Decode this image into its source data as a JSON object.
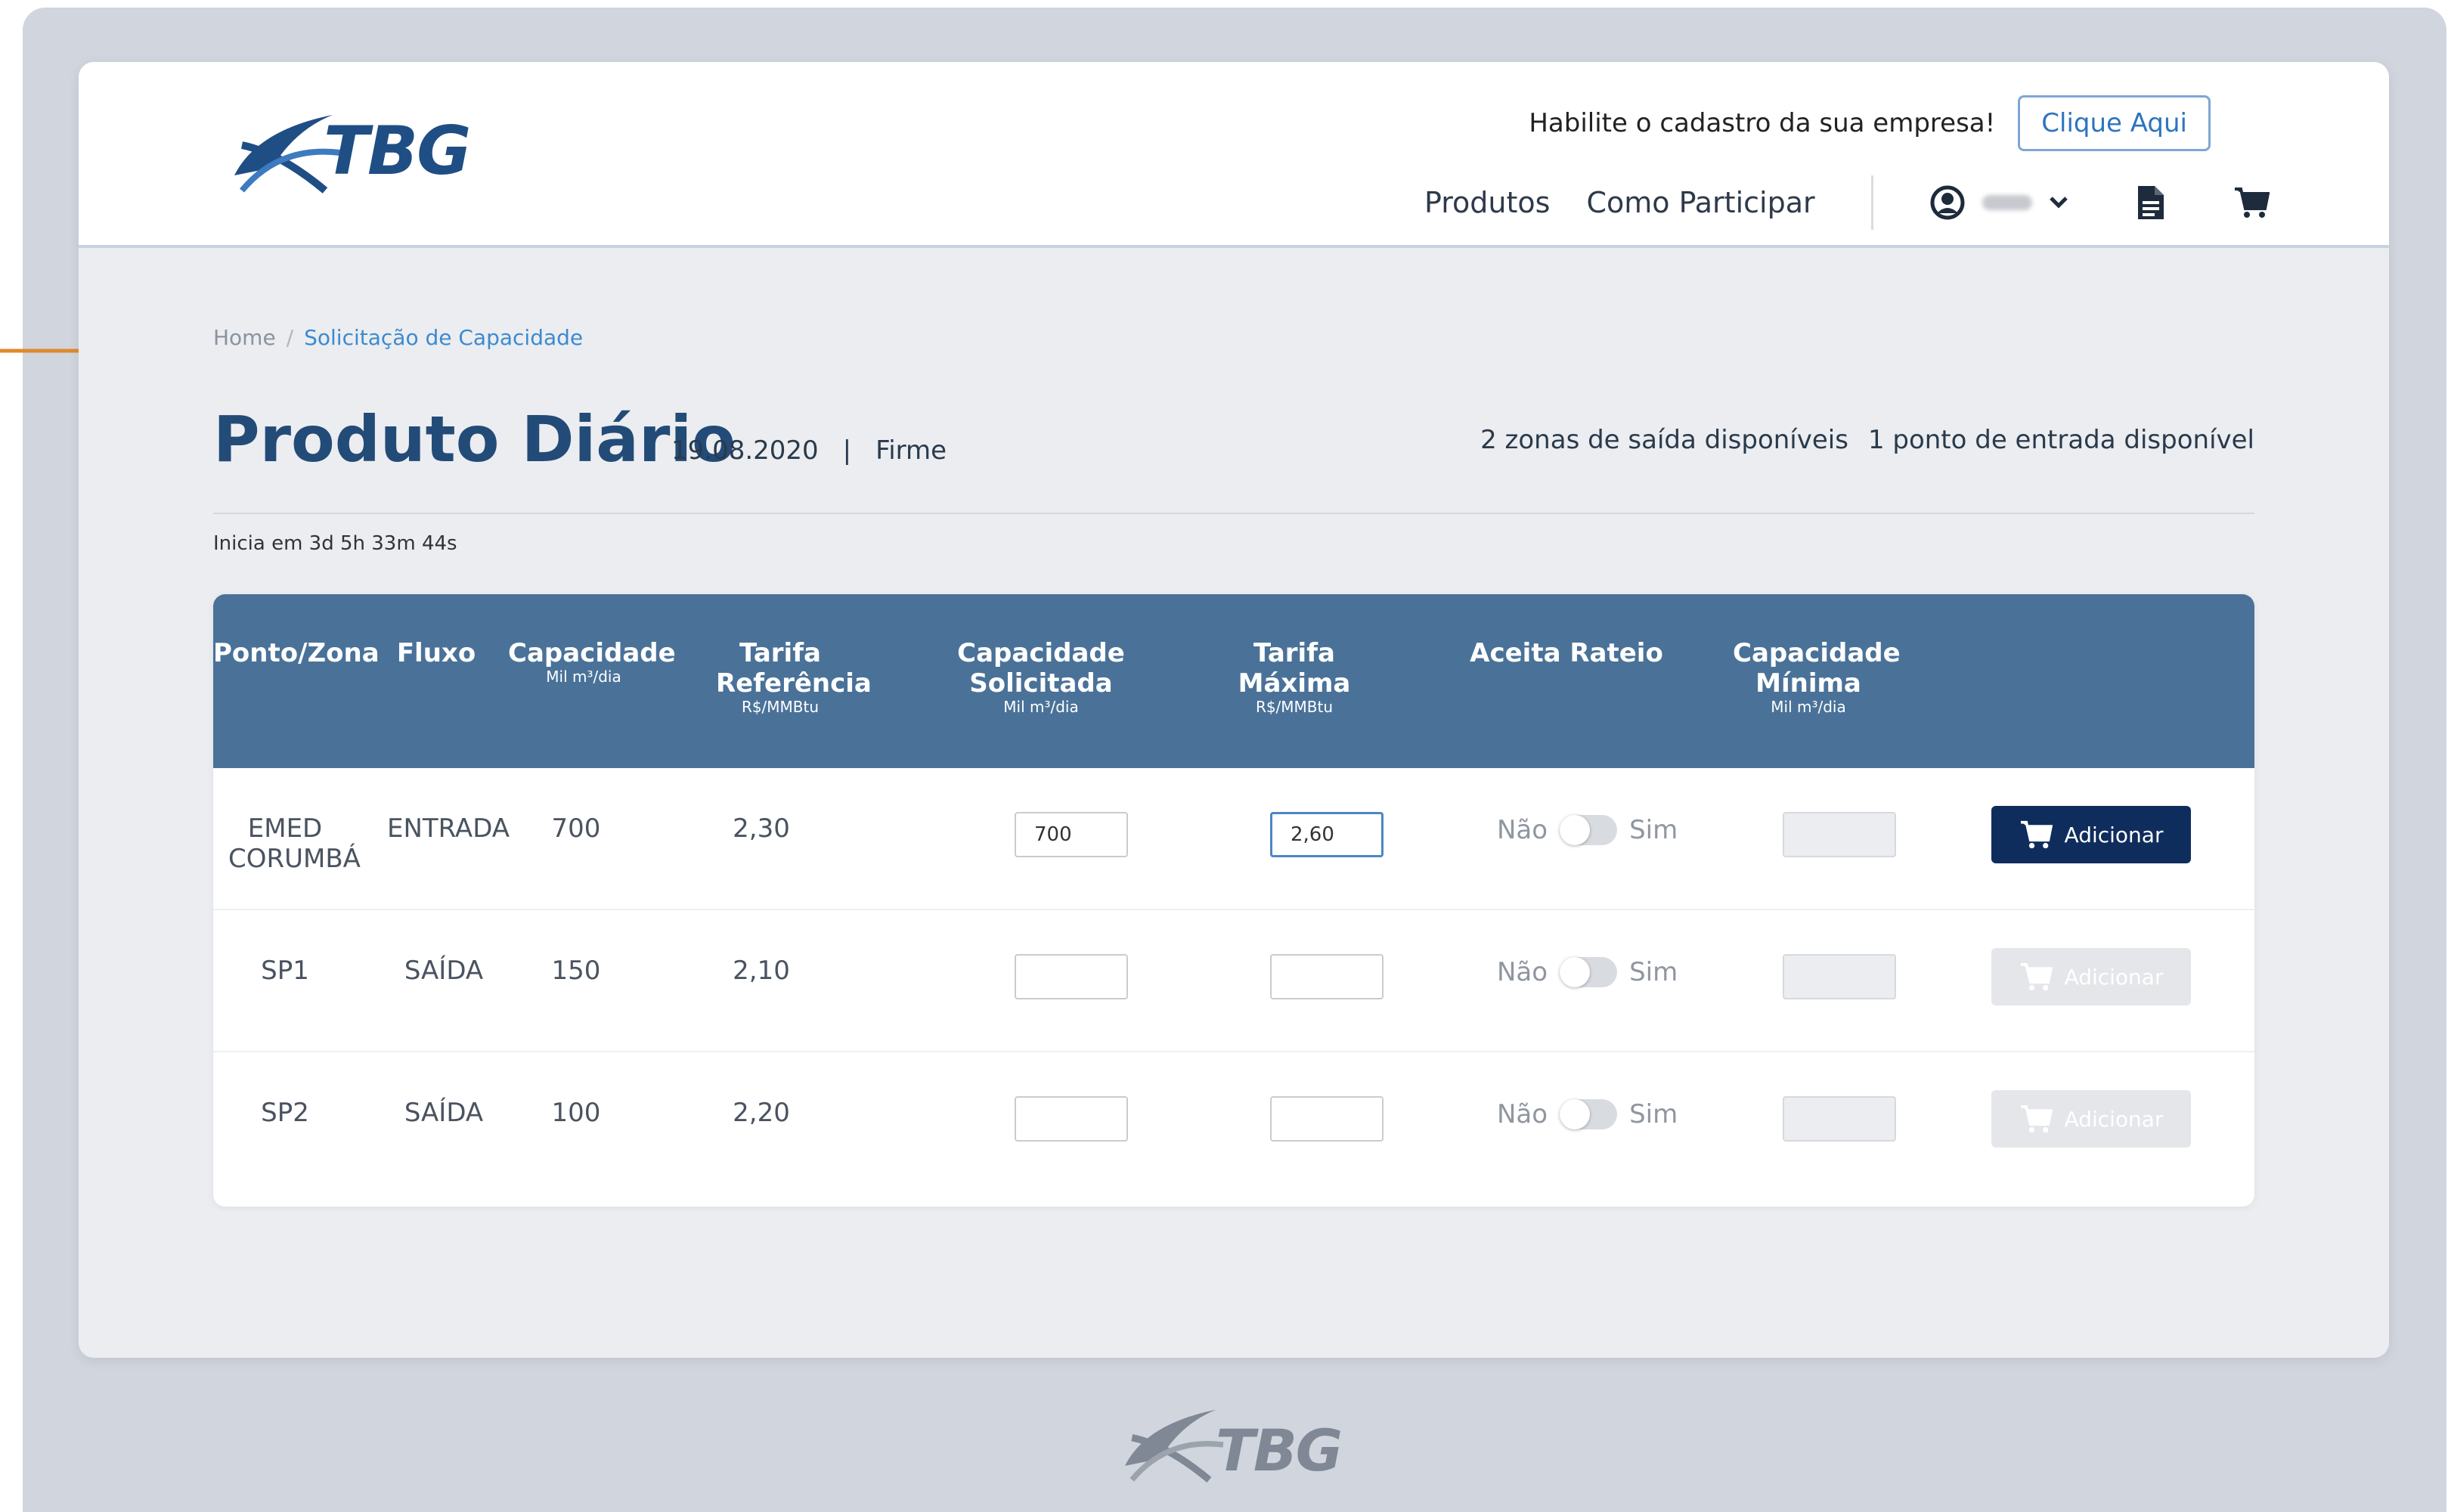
{
  "brand": {
    "logo_text": "TBG",
    "primary_color": "#1f4e84",
    "accent_color": "#e08a2c"
  },
  "header": {
    "promo_text": "Habilite o cadastro da sua empresa!",
    "promo_button": "Clique Aqui",
    "nav": [
      "Produtos",
      "Como Participar"
    ],
    "icons": [
      "user-icon",
      "chevron-down-icon",
      "document-icon",
      "cart-icon"
    ]
  },
  "breadcrumb": {
    "home": "Home",
    "separator": "/",
    "current": "Solicitação de Capacidade"
  },
  "page": {
    "title": "Produto Diário",
    "date": "19.08.2020",
    "divider": "|",
    "type": "Firme",
    "availability_exit": "2 zonas de saída disponíveis",
    "availability_entry": "1 ponto de entrada disponível",
    "countdown": "Inicia em 3d 5h 33m 44s"
  },
  "table": {
    "header_color": "#4a7299",
    "columns": [
      {
        "label": "Ponto/Zona",
        "unit": ""
      },
      {
        "label": "Fluxo",
        "unit": ""
      },
      {
        "label": "Capacidade",
        "unit": "Mil m³/dia"
      },
      {
        "label": "Tarifa Referência",
        "unit": "R$/MMBtu"
      },
      {
        "label": "Capacidade Solicitada",
        "unit": "Mil m³/dia"
      },
      {
        "label": "Tarifa Máxima",
        "unit": "R$/MMBtu"
      },
      {
        "label": "Aceita Rateio",
        "unit": ""
      },
      {
        "label": "Capacidade Mínima",
        "unit": "Mil m³/dia"
      }
    ],
    "toggle_off_label": "Não",
    "toggle_on_label": "Sim",
    "add_button_label": "Adicionar",
    "rows": [
      {
        "point": "EMED CORUMBÁ",
        "flow": "ENTRADA",
        "capacity": "700",
        "ref_rate": "2,30",
        "requested": "700",
        "max_rate": "2,60",
        "accepts_prorate": false,
        "min_capacity": "",
        "add_enabled": true
      },
      {
        "point": "SP1",
        "flow": "SAÍDA",
        "capacity": "150",
        "ref_rate": "2,10",
        "requested": "",
        "max_rate": "",
        "accepts_prorate": false,
        "min_capacity": "",
        "add_enabled": false
      },
      {
        "point": "SP2",
        "flow": "SAÍDA",
        "capacity": "100",
        "ref_rate": "2,20",
        "requested": "",
        "max_rate": "",
        "accepts_prorate": false,
        "min_capacity": "",
        "add_enabled": false
      }
    ]
  },
  "footer": {
    "logo_text": "TBG"
  }
}
